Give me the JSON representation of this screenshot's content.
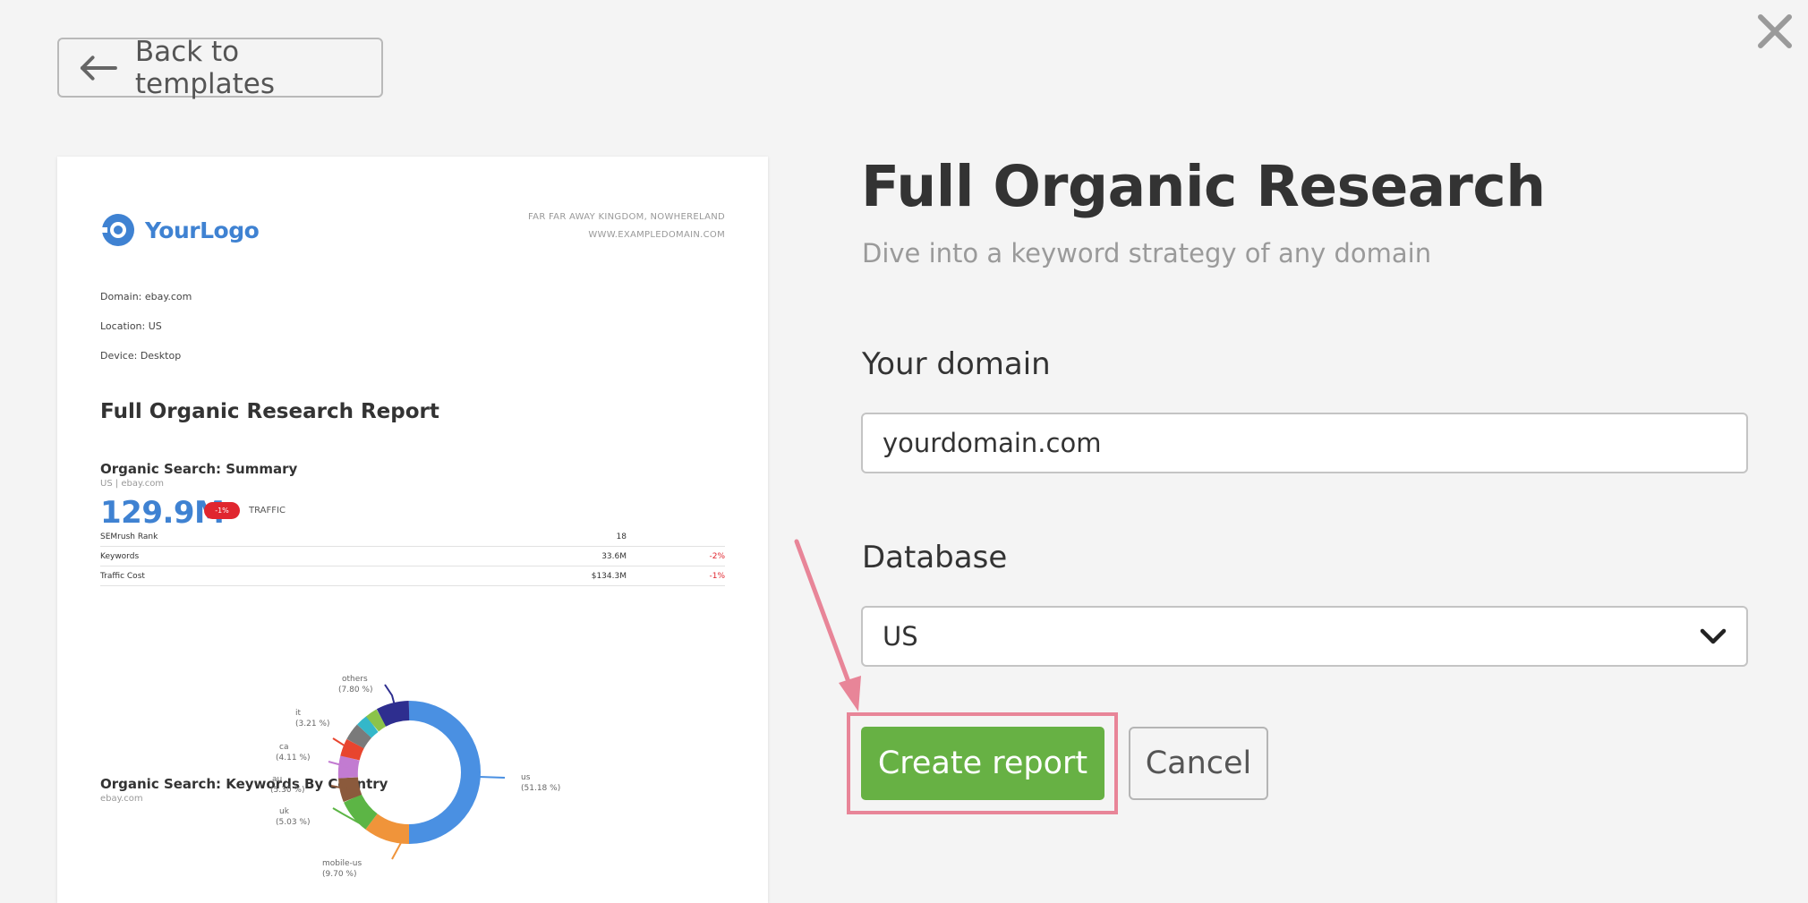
{
  "header": {
    "back_label": "Back to templates",
    "close_icon": "close-icon"
  },
  "preview": {
    "logo_text": "YourLogo",
    "address_line1": "FAR FAR AWAY KINGDOM, NOWHERELAND",
    "address_line2": "WWW.EXAMPLEDOMAIN.COM",
    "meta": [
      "Domain: ebay.com",
      "Location: US",
      "Device: Desktop"
    ],
    "report_title": "Full Organic Research Report",
    "summary_title": "Organic Search: Summary",
    "summary_sub": "US | ebay.com",
    "traffic_value": "129.9M",
    "traffic_badge": "-1%",
    "traffic_label": "TRAFFIC",
    "table": [
      {
        "label": "SEMrush Rank",
        "value": "18",
        "change": ""
      },
      {
        "label": "Keywords",
        "value": "33.6M",
        "change": "-2%"
      },
      {
        "label": "Traffic Cost",
        "value": "$134.3M",
        "change": "-1%"
      }
    ],
    "country_title": "Organic Search: Keywords By Country",
    "country_sub": "ebay.com",
    "donut_labels": [
      {
        "name": "others",
        "pct": "(7.80 %)"
      },
      {
        "name": "it",
        "pct": "(3.21 %)"
      },
      {
        "name": "ca",
        "pct": "(4.11 %)"
      },
      {
        "name": "au",
        "pct": "(5.30 %)"
      },
      {
        "name": "uk",
        "pct": "(5.03 %)"
      },
      {
        "name": "mobile-us",
        "pct": "(9.70 %)"
      },
      {
        "name": "us",
        "pct": "(51.18 %)"
      }
    ],
    "colors": {
      "us": "#4a90e2",
      "mobile_us": "#f0943a",
      "uk": "#5cb545",
      "au": "#8b5a3c",
      "ca": "#c27bd1",
      "others": "#2e2e8f"
    }
  },
  "form": {
    "title": "Full Organic Research",
    "subtitle": "Dive into a keyword strategy of any domain",
    "domain_label": "Your domain",
    "domain_value": "yourdomain.com",
    "database_label": "Database",
    "database_value": "US",
    "create_label": "Create report",
    "cancel_label": "Cancel"
  },
  "colors": {
    "accent_green": "#67b144",
    "highlight_pink": "#e88598"
  }
}
